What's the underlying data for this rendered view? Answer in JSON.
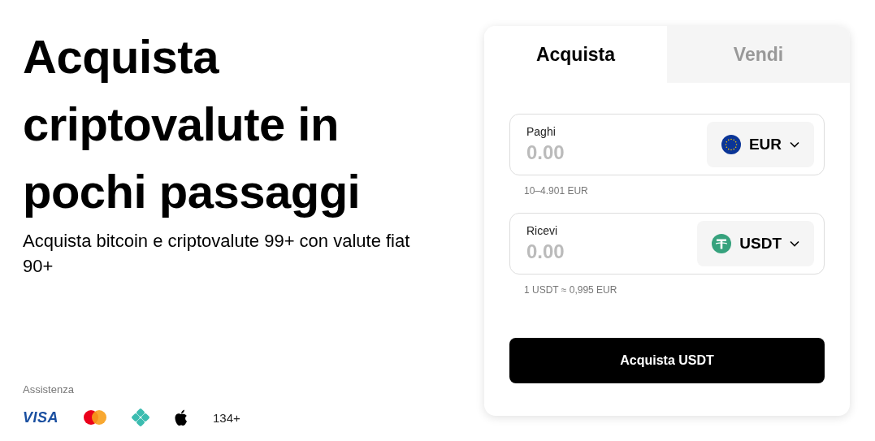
{
  "hero": {
    "title": "Acquista criptovalute in pochi passaggi",
    "subtitle": "Acquista bitcoin e criptovalute 99+ con valute fiat 90+"
  },
  "support": {
    "label": "Assistenza",
    "methods": [
      {
        "kind": "visa",
        "label": "VISA"
      },
      {
        "kind": "mastercard"
      },
      {
        "kind": "diamond"
      },
      {
        "kind": "apple"
      }
    ],
    "more": "134+"
  },
  "card": {
    "tabs": [
      {
        "label": "Acquista",
        "selected": true
      },
      {
        "label": "Vendi",
        "selected": false
      }
    ],
    "fields": [
      {
        "label": "Paghi",
        "placeholder": "0.00",
        "currency": "EUR",
        "kind": "eur",
        "hint": "10–4.901 EUR"
      },
      {
        "label": "Ricevi",
        "placeholder": "0.00",
        "currency": "USDT",
        "kind": "usdt",
        "hint": "1 USDT ≈ 0,995 EUR"
      }
    ],
    "button": "Acquista USDT"
  }
}
